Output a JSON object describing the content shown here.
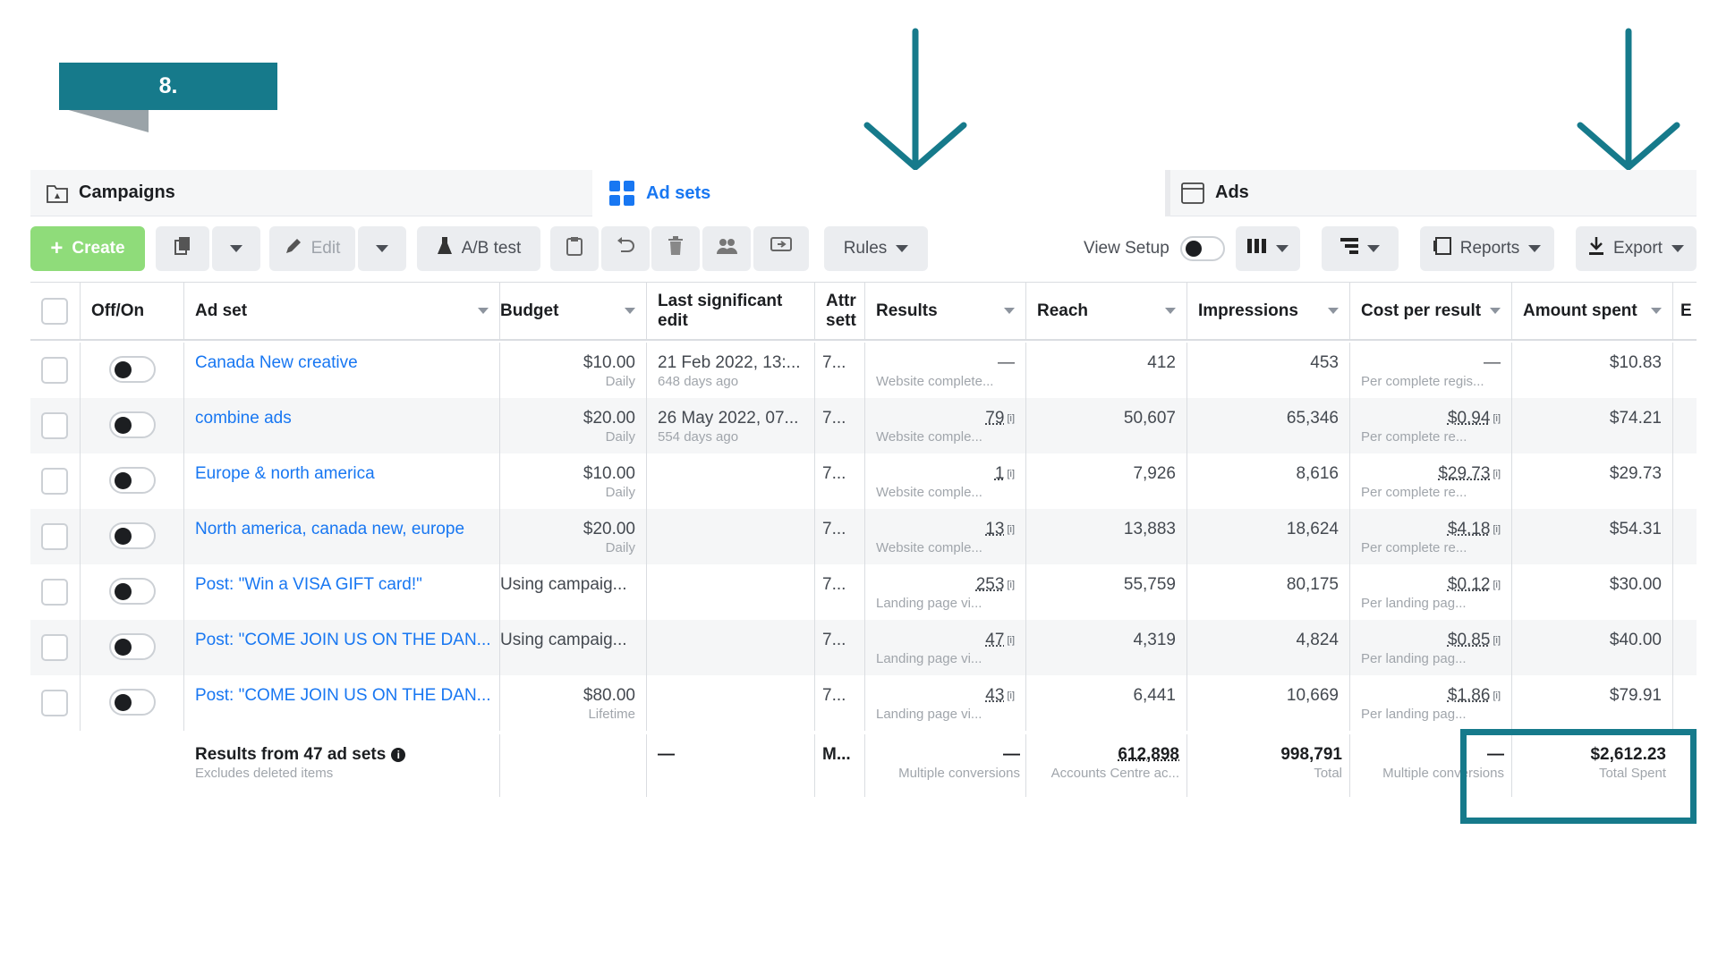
{
  "step_label": "8.",
  "colors": {
    "accent": "#167a8b",
    "link": "#1877f2",
    "create": "#8fdc7a"
  },
  "tabs": [
    {
      "label": "Campaigns",
      "icon": "folder-icon"
    },
    {
      "label": "Ad sets",
      "icon": "grid-icon"
    },
    {
      "label": "Ads",
      "icon": "ad-icon"
    }
  ],
  "toolbar": {
    "create": "Create",
    "edit": "Edit",
    "ab_test": "A/B test",
    "rules": "Rules",
    "view_setup": "View Setup",
    "reports": "Reports",
    "export": "Export"
  },
  "columns": {
    "off_on": "Off/On",
    "ad_set": "Ad set",
    "budget": "Budget",
    "last_edit_1": "Last significant",
    "last_edit_2": "edit",
    "attr_1": "Attr",
    "attr_2": "sett",
    "results": "Results",
    "reach": "Reach",
    "impressions": "Impressions",
    "cost": "Cost per result",
    "amount": "Amount spent",
    "extra": "E"
  },
  "rows": [
    {
      "name": "Canada New creative",
      "budget": "$10.00",
      "budget_sub": "Daily",
      "edit": "21 Feb 2022, 13:...",
      "edit_sub": "648 days ago",
      "attr": "7...",
      "results": "—",
      "results_sub": "Website complete...",
      "reach": "412",
      "impressions": "453",
      "cost": "—",
      "cost_sub": "Per complete regis...",
      "amount": "$10.83"
    },
    {
      "name": "combine ads",
      "budget": "$20.00",
      "budget_sub": "Daily",
      "edit": "26 May 2022, 07...",
      "edit_sub": "554 days ago",
      "attr": "7...",
      "results": "79",
      "results_sub": "Website comple...",
      "reach": "50,607",
      "impressions": "65,346",
      "cost": "$0.94",
      "cost_sub": "Per complete re...",
      "amount": "$74.21"
    },
    {
      "name": "Europe & north america",
      "budget": "$10.00",
      "budget_sub": "Daily",
      "edit": "",
      "edit_sub": "",
      "attr": "7...",
      "results": "1",
      "results_sub": "Website comple...",
      "reach": "7,926",
      "impressions": "8,616",
      "cost": "$29.73",
      "cost_sub": "Per complete re...",
      "amount": "$29.73"
    },
    {
      "name": "North america, canada new, europe",
      "budget": "$20.00",
      "budget_sub": "Daily",
      "edit": "",
      "edit_sub": "",
      "attr": "7...",
      "results": "13",
      "results_sub": "Website comple...",
      "reach": "13,883",
      "impressions": "18,624",
      "cost": "$4.18",
      "cost_sub": "Per complete re...",
      "amount": "$54.31"
    },
    {
      "name": "Post: \"Win a VISA GIFT card!\"",
      "budget": "Using campaig...",
      "budget_sub": "",
      "edit": "",
      "edit_sub": "",
      "attr": "7...",
      "results": "253",
      "results_sub": "Landing page vi...",
      "reach": "55,759",
      "impressions": "80,175",
      "cost": "$0.12",
      "cost_sub": "Per landing pag...",
      "amount": "$30.00"
    },
    {
      "name": "Post: \"COME JOIN US ON THE DAN...",
      "budget": "Using campaig...",
      "budget_sub": "",
      "edit": "",
      "edit_sub": "",
      "attr": "7...",
      "results": "47",
      "results_sub": "Landing page vi...",
      "reach": "4,319",
      "impressions": "4,824",
      "cost": "$0.85",
      "cost_sub": "Per landing pag...",
      "amount": "$40.00"
    },
    {
      "name": "Post: \"COME JOIN US ON THE DAN...",
      "budget": "$80.00",
      "budget_sub": "Lifetime",
      "edit": "",
      "edit_sub": "",
      "attr": "7...",
      "results": "43",
      "results_sub": "Landing page vi...",
      "reach": "6,441",
      "impressions": "10,669",
      "cost": "$1.86",
      "cost_sub": "Per landing pag...",
      "amount": "$79.91"
    }
  ],
  "summary": {
    "title": "Results from 47 ad sets",
    "subtitle": "Excludes deleted items",
    "budget": "—",
    "attr": "M...",
    "results": "—",
    "results_sub": "Multiple conversions",
    "reach": "612,898",
    "reach_sub": "Accounts Centre ac...",
    "impressions": "998,791",
    "impressions_sub": "Total",
    "cost": "—",
    "cost_sub": "Multiple conversions",
    "amount": "$2,612.23",
    "amount_sub": "Total Spent"
  }
}
